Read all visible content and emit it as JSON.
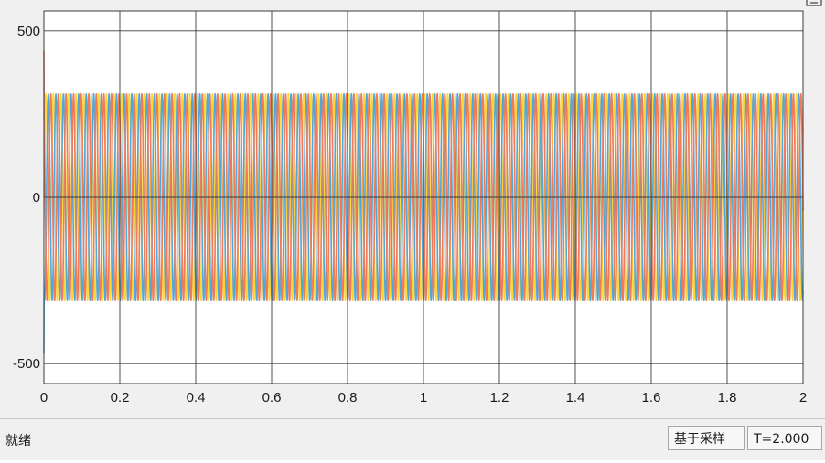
{
  "status": {
    "state": "就绪",
    "sample_mode": "基于采样",
    "time": "T=2.000"
  },
  "colors": {
    "background": "#f0f0f0",
    "plot_bg": "#ffffff",
    "grid": "#3c3c3c",
    "series": [
      "#ffd633",
      "#4ea8de",
      "#f07a5a"
    ]
  },
  "chart_data": {
    "type": "line",
    "title": "",
    "xlabel": "",
    "ylabel": "",
    "xlim": [
      0,
      2
    ],
    "ylim": [
      -560,
      560
    ],
    "x_ticks": [
      0,
      0.2,
      0.4,
      0.6,
      0.8,
      1,
      1.2,
      1.4,
      1.6,
      1.8,
      2
    ],
    "x_tick_labels": [
      "0",
      "0.2",
      "0.4",
      "0.6",
      "0.8",
      "1",
      "1.2",
      "1.4",
      "1.6",
      "1.8",
      "2"
    ],
    "y_ticks": [
      -500,
      0,
      500
    ],
    "y_tick_labels": [
      "-500",
      "0",
      "500"
    ],
    "grid": true,
    "series": [
      {
        "amplitude": 311,
        "frequency_hz": 50,
        "phase_deg": 0,
        "color": "#ffd633",
        "initial_spike": 0
      },
      {
        "amplitude": 311,
        "frequency_hz": 50,
        "phase_deg": -120,
        "color": "#4ea8de",
        "initial_spike": -470
      },
      {
        "amplitude": 311,
        "frequency_hz": 50,
        "phase_deg": 120,
        "color": "#f07a5a",
        "initial_spike": 440
      }
    ]
  }
}
